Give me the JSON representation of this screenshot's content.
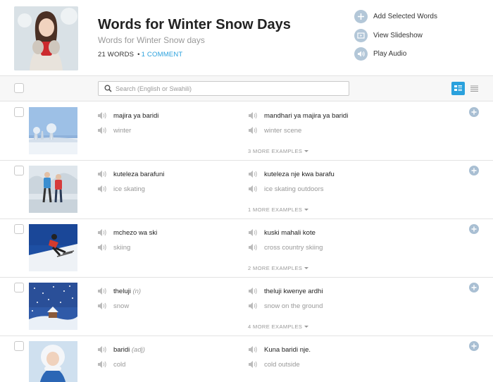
{
  "header": {
    "title": "Words for Winter Snow Days",
    "subtitle": "Words for Winter Snow days",
    "word_count": "21 WORDS",
    "separator": "•",
    "comment_link": "1 COMMENT"
  },
  "actions": [
    {
      "label": "Add Selected Words",
      "icon": "plus-circle-icon"
    },
    {
      "label": "View Slideshow",
      "icon": "slideshow-icon"
    },
    {
      "label": "Play Audio",
      "icon": "speaker-icon"
    }
  ],
  "search": {
    "placeholder": "Search (English or Swahili)"
  },
  "colors": {
    "accent": "#2aa1dd",
    "muted": "#999999",
    "icon_blue": "#a9bfd3"
  },
  "rows": [
    {
      "word": "majira ya baridi",
      "pos": "",
      "translation": "winter",
      "example": "mandhari ya majira ya baridi",
      "example_translation": "winter scene",
      "more": "3 MORE EXAMPLES"
    },
    {
      "word": "kuteleza barafuni",
      "pos": "",
      "translation": "ice skating",
      "example": "kuteleza nje kwa barafu",
      "example_translation": "ice skating outdoors",
      "more": "1 MORE EXAMPLES"
    },
    {
      "word": "mchezo wa ski",
      "pos": "",
      "translation": "skiing",
      "example": "kuski mahali kote",
      "example_translation": "cross country skiing",
      "more": "2 MORE EXAMPLES"
    },
    {
      "word": "theluji",
      "pos": "(n)",
      "translation": "snow",
      "example": "theluji kwenye ardhi",
      "example_translation": "snow on the ground",
      "more": "4 MORE EXAMPLES"
    },
    {
      "word": "baridi",
      "pos": "(adj)",
      "translation": "cold",
      "example": "Kuna baridi nje.",
      "example_translation": "cold outside",
      "more": ""
    }
  ]
}
